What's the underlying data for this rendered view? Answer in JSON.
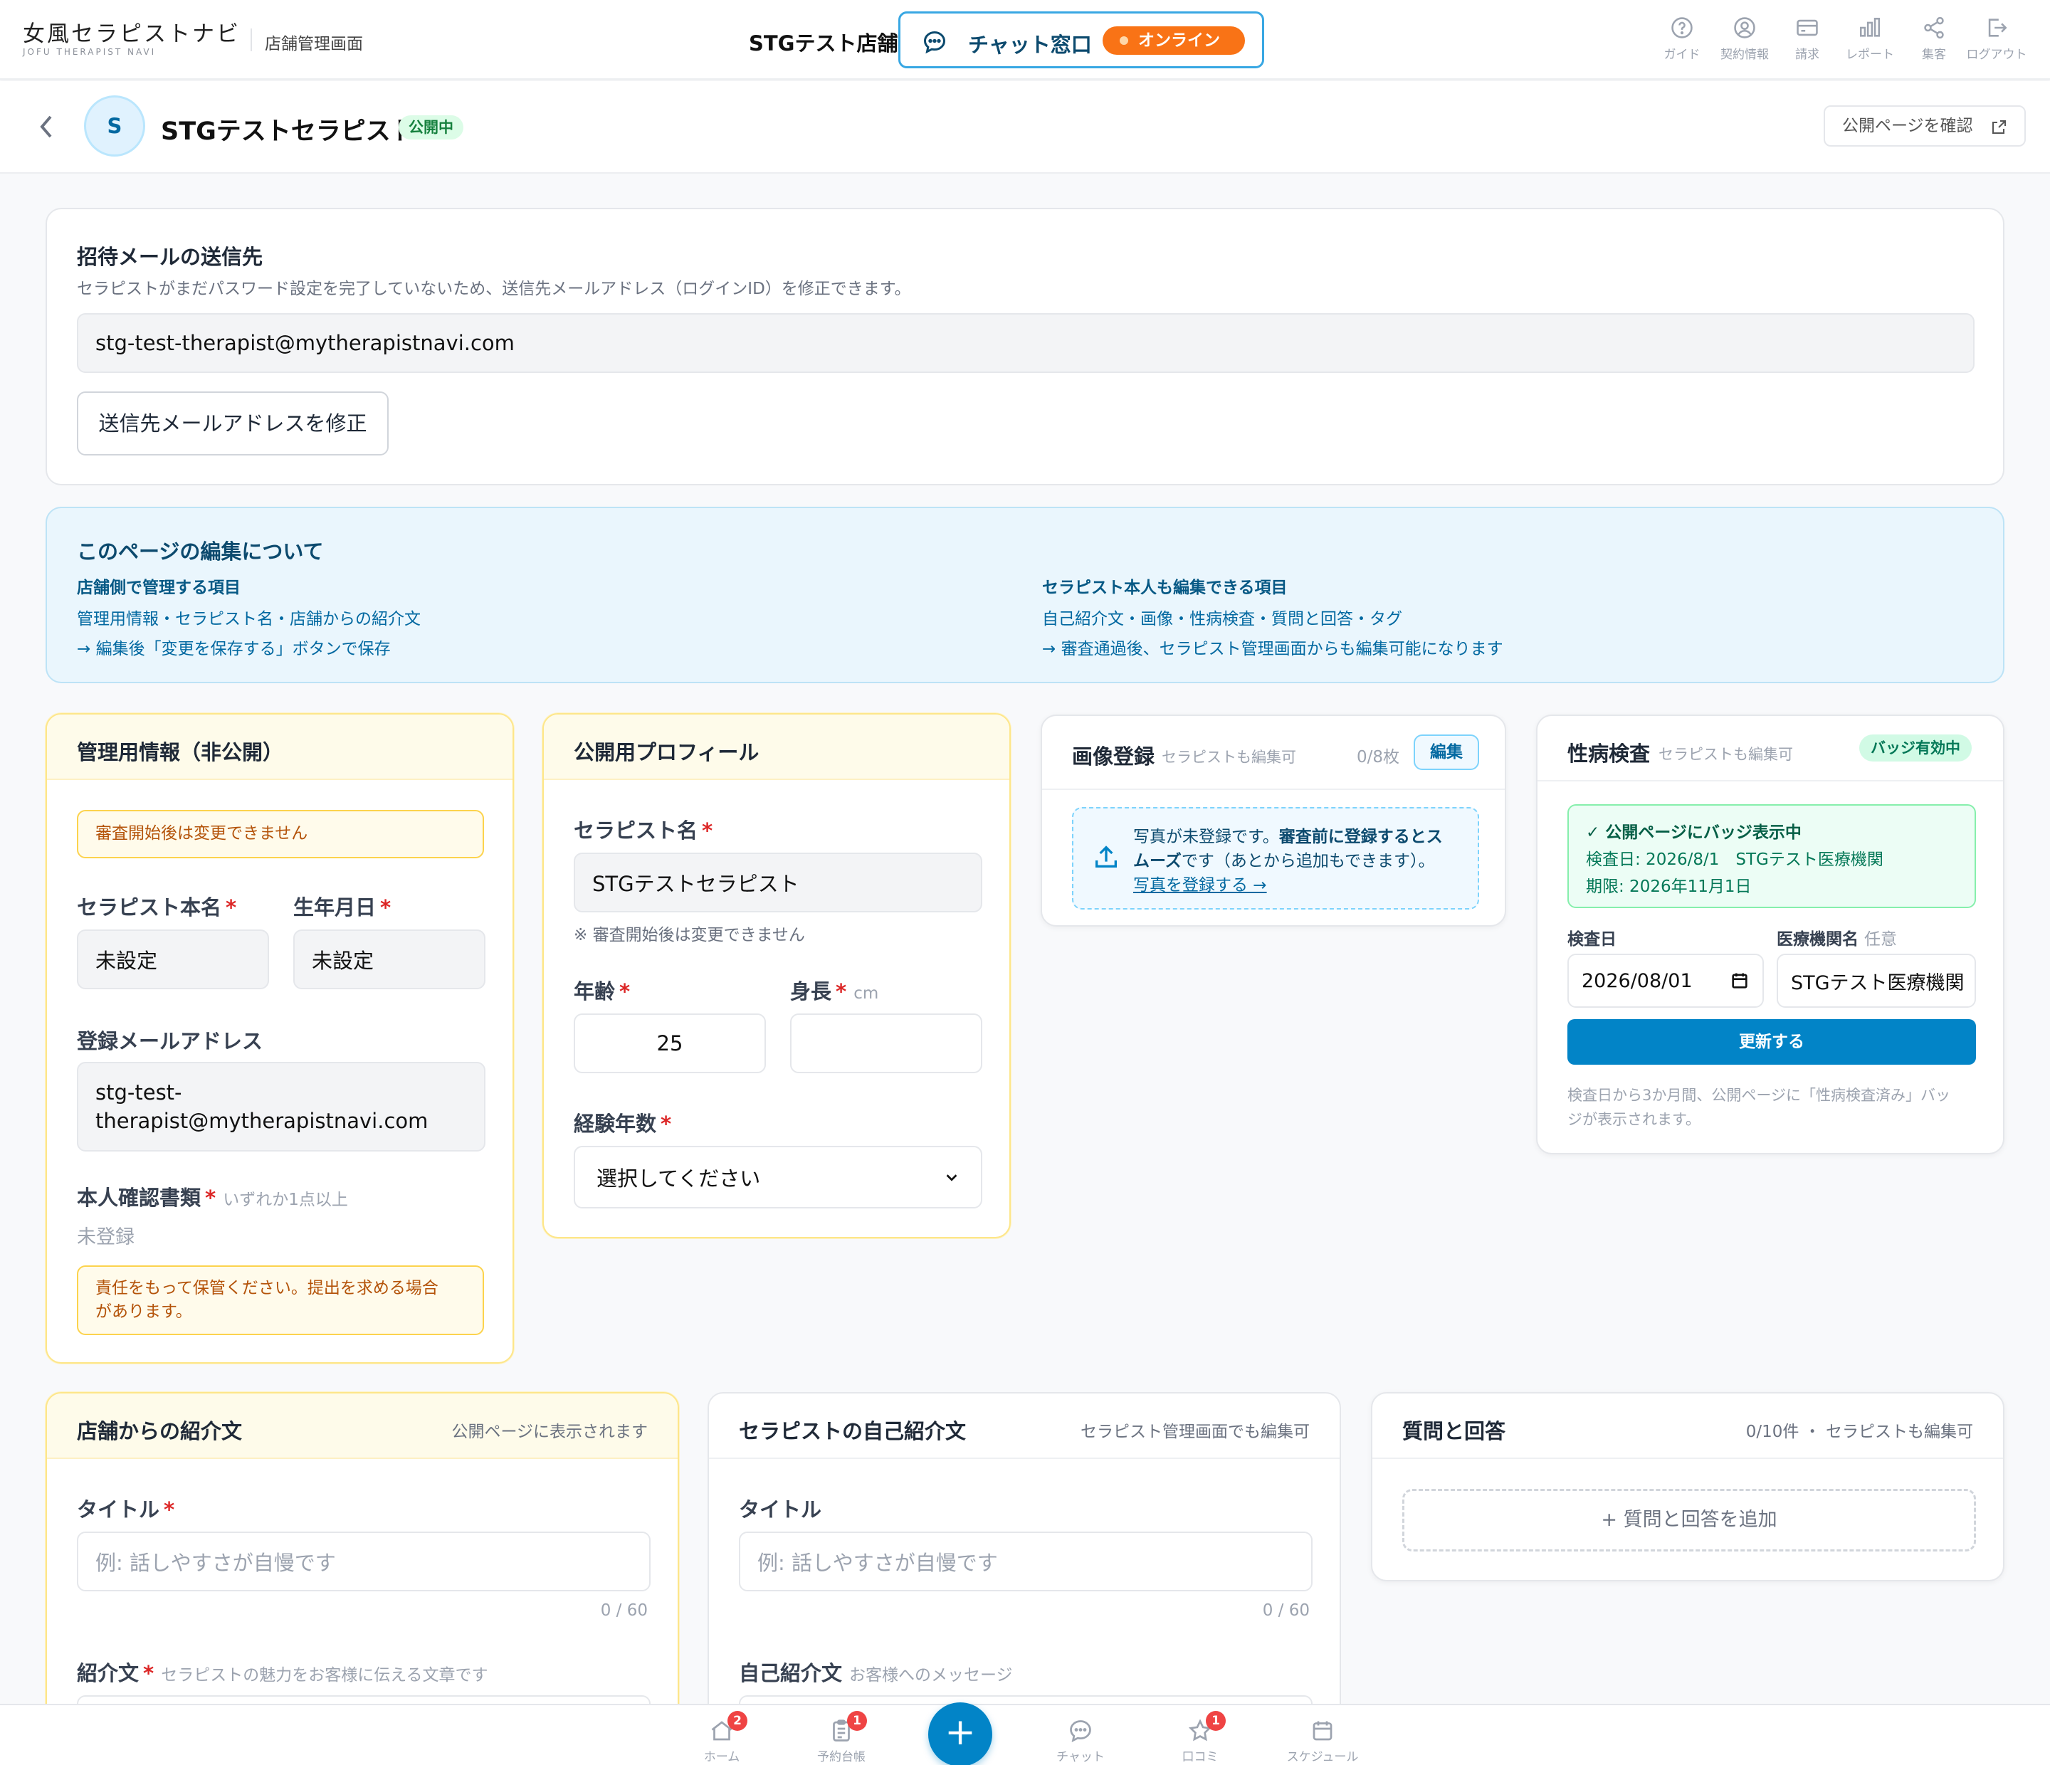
{
  "header": {
    "logo_text": "女風セラピストナビ",
    "logo_sub": "JOFU THERAPIST NAVI",
    "admin_label": "店舗管理画面",
    "shop_name": "STGテスト店舗",
    "chat_label": "チャット窓口",
    "online_label": "オンライン",
    "nav": [
      {
        "label": "ガイド",
        "icon": "help-circle-icon"
      },
      {
        "label": "契約情報",
        "icon": "user-circle-icon"
      },
      {
        "label": "請求",
        "icon": "credit-card-icon"
      },
      {
        "label": "レポート",
        "icon": "bar-chart-icon"
      },
      {
        "label": "集客",
        "icon": "share-icon"
      },
      {
        "label": "ログアウト",
        "icon": "logout-icon"
      }
    ]
  },
  "subheader": {
    "avatar_initial": "S",
    "name": "STGテストセラピスト",
    "status": "公開中",
    "public_page_btn": "公開ページを確認"
  },
  "invite": {
    "title": "招待メールの送信先",
    "desc": "セラピストがまだパスワード設定を完了していないため、送信先メールアドレス（ログインID）を修正できます。",
    "email": "stg-test-therapist@mytherapistnavi.com",
    "button": "送信先メールアドレスを修正"
  },
  "info": {
    "title": "このページの編集について",
    "left_head": "店舗側で管理する項目",
    "left_items": "管理用情報・セラピスト名・店舗からの紹介文",
    "left_note": "→ 編集後「変更を保存する」ボタンで保存",
    "right_head": "セラピスト本人も編集できる項目",
    "right_items": "自己紹介文・画像・性病検査・質問と回答・タグ",
    "right_note": "→ 審査通過後、セラピスト管理画面からも編集可能になります"
  },
  "admin_info": {
    "title": "管理用情報（非公開）",
    "warning": "審査開始後は変更できません",
    "real_name_label": "セラピスト本名",
    "real_name": "未設定",
    "birth_label": "生年月日",
    "birth": "未設定",
    "email_label": "登録メールアドレス",
    "email_line1": "stg-test-",
    "email_line2": "therapist@mytherapistnavi.com",
    "id_doc_label": "本人確認書類",
    "id_doc_hint": "いずれか1点以上",
    "id_doc_status": "未登録",
    "id_doc_note_line1": "責任をもって保管ください。提出を求める場合",
    "id_doc_note_line2": "があります。"
  },
  "public_profile": {
    "title": "公開用プロフィール",
    "name_label": "セラピスト名",
    "name": "STGテストセラピスト",
    "name_note": "※ 審査開始後は変更できません",
    "age_label": "年齢",
    "age": "25",
    "height_label": "身長",
    "height_unit": "cm",
    "height": "",
    "exp_label": "経験年数",
    "exp_select": "選択してください"
  },
  "images": {
    "title": "画像登録",
    "sub": "セラピストも編集可",
    "count": "0/8枚",
    "edit_btn": "編集",
    "msg_line1_a": "写真が未登録です。",
    "msg_line1_b": "審査前に登録するとス",
    "msg_line2_a": "ムーズ",
    "msg_line2_b": "です（あとから追加もできます）。",
    "link": "写真を登録する →"
  },
  "std_test": {
    "title": "性病検査",
    "sub": "セラピストも編集可",
    "badge": "バッジ有効中",
    "status_title": "✓ 公開ページにバッジ表示中",
    "status_date": "検査日: 2026/8/1　STGテスト医療機関",
    "status_expire": "期限: 2026年11月1日",
    "date_label": "検査日",
    "date_value": "2026/08/01",
    "clinic_label": "医療機関名",
    "clinic_hint": "任意",
    "clinic_value": "STGテスト医療機関",
    "update_btn": "更新する",
    "note_line1": "検査日から3か月間、公開ページに「性病検査済み」バッ",
    "note_line2": "ジが表示されます。"
  },
  "shop_intro": {
    "title": "店舗からの紹介文",
    "sub": "公開ページに表示されます",
    "title_label": "タイトル",
    "title_placeholder": "例: 話しやすさが自慢です",
    "counter": "0 / 60",
    "body_label": "紹介文",
    "body_hint": "セラピストの魅力をお客様に伝える文章です"
  },
  "self_intro": {
    "title": "セラピストの自己紹介文",
    "sub": "セラピスト管理画面でも編集可",
    "title_label": "タイトル",
    "title_placeholder": "例: 話しやすさが自慢です",
    "counter": "0 / 60",
    "body_label": "自己紹介文",
    "body_hint": "お客様へのメッセージ"
  },
  "qa": {
    "title": "質問と回答",
    "sub": "0/10件 ・ セラピストも編集可",
    "add_btn": "+ 質問と回答を追加"
  },
  "bottom_nav": [
    {
      "label": "ホーム",
      "badge": "2",
      "icon": "home-icon"
    },
    {
      "label": "予約台帳",
      "badge": "1",
      "icon": "clipboard-icon"
    },
    {
      "label": "チャット",
      "badge": "",
      "icon": "chat-icon"
    },
    {
      "label": "口コミ",
      "badge": "1",
      "icon": "star-icon"
    },
    {
      "label": "スケジュール",
      "badge": "",
      "icon": "calendar-icon"
    }
  ],
  "fab_label": "+",
  "colors": {
    "accent": "#0284c7",
    "online": "#f97316",
    "warning_bg": "#fffbeb",
    "success": "#15803d"
  }
}
